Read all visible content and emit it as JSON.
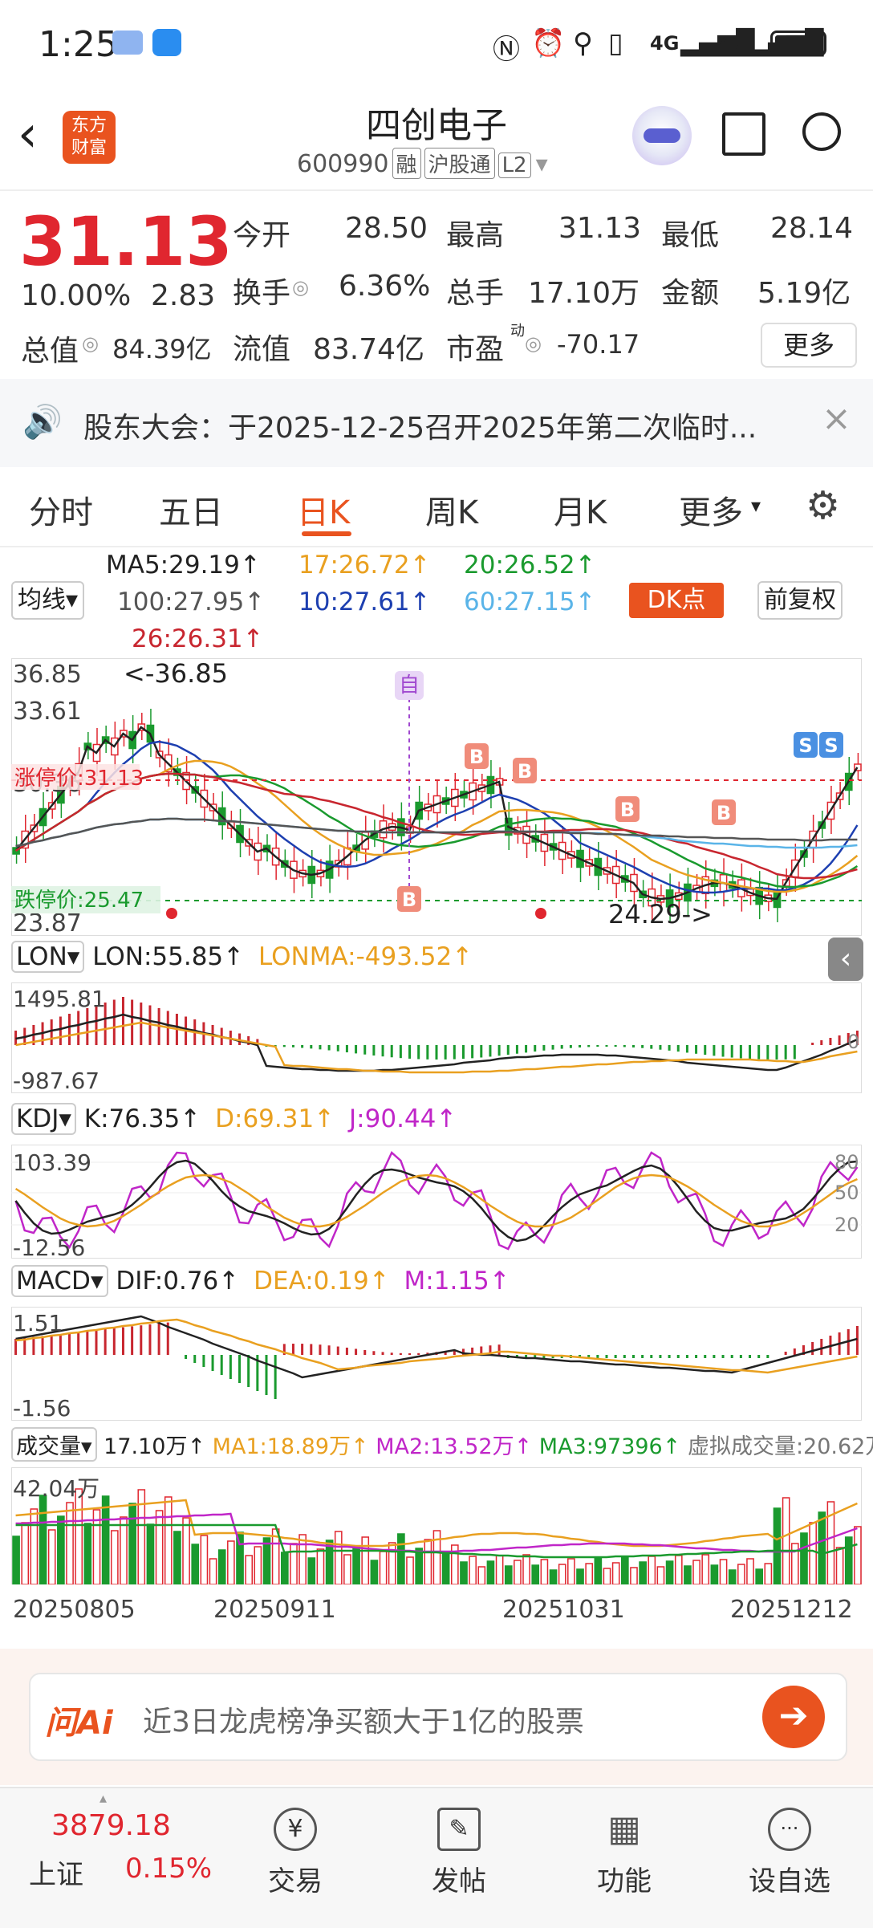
{
  "status_bar": {
    "time": "1:25",
    "network1": "4G",
    "network2": "4G"
  },
  "header": {
    "title": "四创电子",
    "code": "600990",
    "tags": [
      "融",
      "沪股通",
      "L2"
    ],
    "logo_line1": "东方",
    "logo_line2": "财富"
  },
  "quote": {
    "price": "31.13",
    "change_pct": "10.00%",
    "change": "2.83",
    "total_value_label": "总值",
    "total_value": "84.39亿",
    "open_label": "今开",
    "open": "28.50",
    "high_label": "最高",
    "high": "31.13",
    "low_label": "最低",
    "low": "28.14",
    "turnover_label": "换手",
    "turnover": "6.36%",
    "volume_label": "总手",
    "volume": "17.10万",
    "amount_label": "金额",
    "amount": "5.19亿",
    "float_label": "流值",
    "float_value": "83.74亿",
    "pe_label": "市盈",
    "pe_sup": "动",
    "pe": "-70.17",
    "more_button": "更多"
  },
  "notice": {
    "text": "股东大会：于2025-12-25召开2025年第二次临时..."
  },
  "tabs": [
    "分时",
    "五日",
    "日K",
    "周K",
    "月K",
    "更多"
  ],
  "active_tab": "日K",
  "ma_panel": {
    "selector": "均线",
    "ma5": "MA5:29.19↑",
    "ma17": "17:26.72↑",
    "ma20": "20:26.52↑",
    "ma100": "100:27.95↑",
    "ma10": "10:27.61↑",
    "ma60": "60:27.15↑",
    "ma26": "26:26.31↑",
    "dk_button": "DK点",
    "adjust_button": "前复权"
  },
  "kline": {
    "y_max": "36.85",
    "y2": "33.61",
    "y3": "30.36",
    "y_min": "23.87",
    "peak_label": "<-36.85",
    "low_label": "24.29->",
    "limit_up": "涨停价:31.13",
    "limit_down": "跌停价:25.47",
    "mark_self": "自"
  },
  "lon_panel": {
    "selector": "LON",
    "lon": "LON:55.85↑",
    "lonma": "LONMA:-493.52↑",
    "y_max": "1495.81",
    "y_min": "-987.67",
    "zero": "0"
  },
  "kdj_panel": {
    "selector": "KDJ",
    "k": "K:76.35↑",
    "d": "D:69.31↑",
    "j": "J:90.44↑",
    "y_max": "103.39",
    "y_min": "-12.56",
    "r80": "80",
    "r50": "50",
    "r20": "20"
  },
  "macd_panel": {
    "selector": "MACD",
    "dif": "DIF:0.76↑",
    "dea": "DEA:0.19↑",
    "m": "M:1.15↑",
    "y_max": "1.51",
    "y_min": "-1.56"
  },
  "vol_panel": {
    "selector": "成交量",
    "vol": "17.10万↑",
    "ma1": "MA1:18.89万↑",
    "ma2": "MA2:13.52万↑",
    "ma3": "MA3:97396↑",
    "virtual": "虚拟成交量:20.62万",
    "y_max": "42.04万"
  },
  "dates": [
    "20250805",
    "20250911",
    "20251031",
    "20251212"
  ],
  "ask": {
    "brand": "问Ai",
    "placeholder": "近3日龙虎榜净买额大于1亿的股票"
  },
  "bottom_nav": {
    "index_value": "3879.18",
    "index_name": "上证",
    "index_change": "0.15%",
    "items": [
      "交易",
      "发帖",
      "功能",
      "设自选"
    ]
  },
  "colors": {
    "up": "#e0262f",
    "down": "#1a9a2e",
    "accent": "#e9531f"
  }
}
